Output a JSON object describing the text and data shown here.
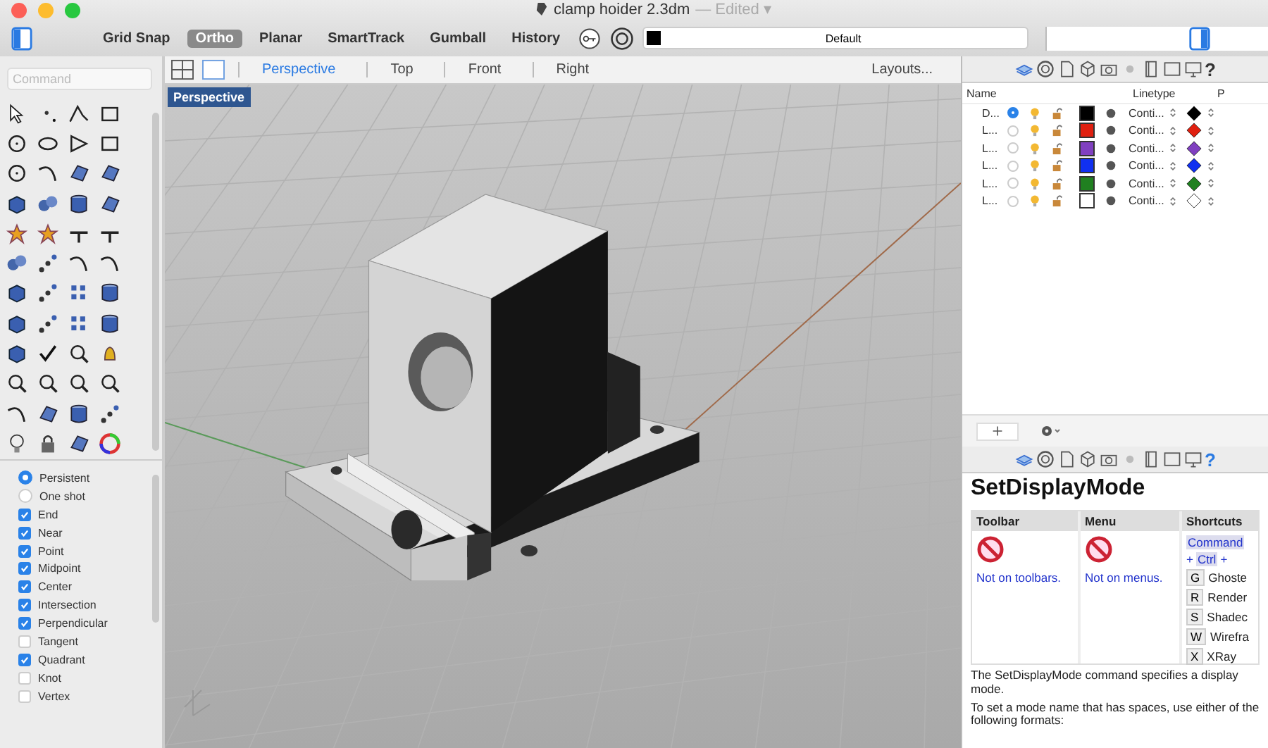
{
  "window": {
    "title": "clamp hoider 2.3dm",
    "title_suffix": "— Edited ▾"
  },
  "toolbar": {
    "toggles": [
      {
        "label": "Grid Snap",
        "on": false
      },
      {
        "label": "Ortho",
        "on": true
      },
      {
        "label": "Planar",
        "on": false
      },
      {
        "label": "SmartTrack",
        "on": false
      },
      {
        "label": "Gumball",
        "on": false
      },
      {
        "label": "History",
        "on": false
      }
    ],
    "layer_field": {
      "value": "Default",
      "color": "#000000"
    }
  },
  "command": {
    "placeholder": "Command"
  },
  "osnap": {
    "modes": [
      {
        "label": "Persistent",
        "selected": true
      },
      {
        "label": "One shot",
        "selected": false
      }
    ],
    "items": [
      {
        "label": "End",
        "checked": true
      },
      {
        "label": "Near",
        "checked": true
      },
      {
        "label": "Point",
        "checked": true
      },
      {
        "label": "Midpoint",
        "checked": true
      },
      {
        "label": "Center",
        "checked": true
      },
      {
        "label": "Intersection",
        "checked": true
      },
      {
        "label": "Perpendicular",
        "checked": true
      },
      {
        "label": "Tangent",
        "checked": false
      },
      {
        "label": "Quadrant",
        "checked": true
      },
      {
        "label": "Knot",
        "checked": false
      },
      {
        "label": "Vertex",
        "checked": false
      }
    ]
  },
  "viewport_tabs": [
    {
      "label": "Perspective",
      "selected": true
    },
    {
      "label": "Top",
      "selected": false
    },
    {
      "label": "Front",
      "selected": false
    },
    {
      "label": "Right",
      "selected": false
    }
  ],
  "layouts_button": "Layouts...",
  "viewport": {
    "label": "Perspective"
  },
  "panel_help_glyph": "?",
  "layers": {
    "columns": [
      "Name",
      "Linetype",
      "P"
    ],
    "rows": [
      {
        "name": "D...",
        "current": true,
        "color": "#000000",
        "linetype": "Conti...",
        "print": {
          "color": "#000000"
        }
      },
      {
        "name": "L...",
        "current": false,
        "color": "#e02010",
        "linetype": "Conti...",
        "print": {
          "color": "#e02010"
        }
      },
      {
        "name": "L...",
        "current": false,
        "color": "#8040c0",
        "linetype": "Conti...",
        "print": {
          "color": "#8040c0"
        }
      },
      {
        "name": "L...",
        "current": false,
        "color": "#1030f0",
        "linetype": "Conti...",
        "print": {
          "color": "#1030f0"
        }
      },
      {
        "name": "L...",
        "current": false,
        "color": "#208020",
        "linetype": "Conti...",
        "print": {
          "color": "#208020"
        }
      },
      {
        "name": "L...",
        "current": false,
        "color": "#ffffff",
        "linetype": "Conti...",
        "print": {
          "color": "#ffffff"
        }
      }
    ]
  },
  "help": {
    "help_glyph": "?",
    "title": "SetDisplayMode",
    "columns": [
      "Toolbar",
      "Menu",
      "Shortcuts"
    ],
    "toolbar_note": "Not on toolbars.",
    "menu_note": "Not on menus.",
    "modifiers": [
      "Command",
      "+",
      "Ctrl",
      "+"
    ],
    "shortcuts": [
      {
        "key": "G",
        "label": "Ghoste"
      },
      {
        "key": "R",
        "label": "Render"
      },
      {
        "key": "S",
        "label": "Shadec"
      },
      {
        "key": "W",
        "label": "Wirefra"
      },
      {
        "key": "X",
        "label": "XRay"
      }
    ],
    "paragraphs": [
      "The SetDisplayMode command specifies a display mode.",
      "To set a mode name that has spaces, use either of the following formats:"
    ]
  }
}
